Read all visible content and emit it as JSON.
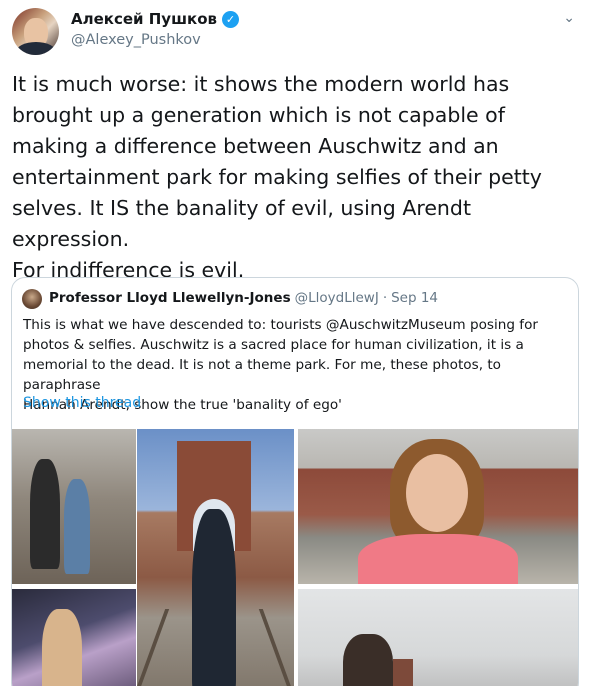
{
  "tweet": {
    "author": {
      "name": "Алексей Пушков",
      "handle": "@Alexey_Pushkov",
      "verified": true
    },
    "text": "It is much worse: it shows the modern world has\nbrought up a generation which is not capable of\nmaking a difference between Auschwitz and an\nentertainment park for making selfies of their petty\nselves. It IS the banality of evil, using Arendt expression.\nFor indifference is evil.",
    "menu_icon": "chevron-down-icon"
  },
  "quoted_tweet": {
    "author": {
      "name": "Professor Lloyd Llewellyn-Jones",
      "handle": "@LloydLlewJ",
      "separator": "·",
      "date": "Sep 14"
    },
    "text": "This is what we have descended to: tourists @AuschwitzMuseum posing for\nphotos & selfies. Auschwitz is a sacred place for human civilization, it is a\nmemorial to the dead. It is not a theme park. For me, these photos, to paraphrase\nHannah Arendt, show the true 'banality of ego'",
    "show_thread": "Show this thread",
    "photo_count": 5
  },
  "colors": {
    "link": "#1b95e0",
    "verified": "#1da1f2",
    "secondary_text": "#657786",
    "border": "#ccd6dd"
  }
}
